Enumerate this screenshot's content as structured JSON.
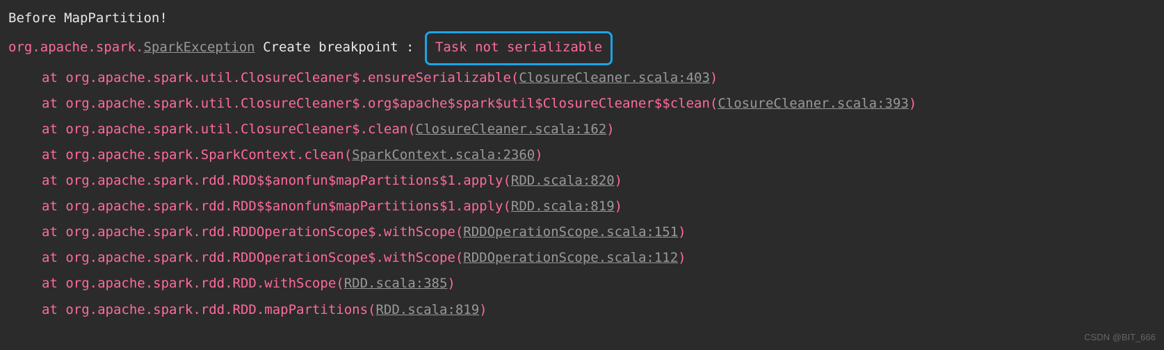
{
  "log": {
    "header": "Before MapPartition!",
    "exception_prefix": "org.apache.spark.",
    "exception_class": "SparkException",
    "breakpoint_label": "Create breakpoint",
    "colon": " :",
    "exception_message": "Task not serializable"
  },
  "frames": [
    {
      "at": "at ",
      "method": "org.apache.spark.util.ClosureCleaner$.ensureSerializable(",
      "location": "ClosureCleaner.scala:403",
      "close": ")"
    },
    {
      "at": "at ",
      "method": "org.apache.spark.util.ClosureCleaner$.org$apache$spark$util$ClosureCleaner$$clean(",
      "location": "ClosureCleaner.scala:393",
      "close": ")"
    },
    {
      "at": "at ",
      "method": "org.apache.spark.util.ClosureCleaner$.clean(",
      "location": "ClosureCleaner.scala:162",
      "close": ")"
    },
    {
      "at": "at ",
      "method": "org.apache.spark.SparkContext.clean(",
      "location": "SparkContext.scala:2360",
      "close": ")"
    },
    {
      "at": "at ",
      "method": "org.apache.spark.rdd.RDD$$anonfun$mapPartitions$1.apply(",
      "location": "RDD.scala:820",
      "close": ")"
    },
    {
      "at": "at ",
      "method": "org.apache.spark.rdd.RDD$$anonfun$mapPartitions$1.apply(",
      "location": "RDD.scala:819",
      "close": ")"
    },
    {
      "at": "at ",
      "method": "org.apache.spark.rdd.RDDOperationScope$.withScope(",
      "location": "RDDOperationScope.scala:151",
      "close": ")"
    },
    {
      "at": "at ",
      "method": "org.apache.spark.rdd.RDDOperationScope$.withScope(",
      "location": "RDDOperationScope.scala:112",
      "close": ")"
    },
    {
      "at": "at ",
      "method": "org.apache.spark.rdd.RDD.withScope(",
      "location": "RDD.scala:385",
      "close": ")"
    },
    {
      "at": "at ",
      "method": "org.apache.spark.rdd.RDD.mapPartitions(",
      "location": "RDD.scala:819",
      "close": ")"
    }
  ],
  "watermark": "CSDN @BIT_666"
}
